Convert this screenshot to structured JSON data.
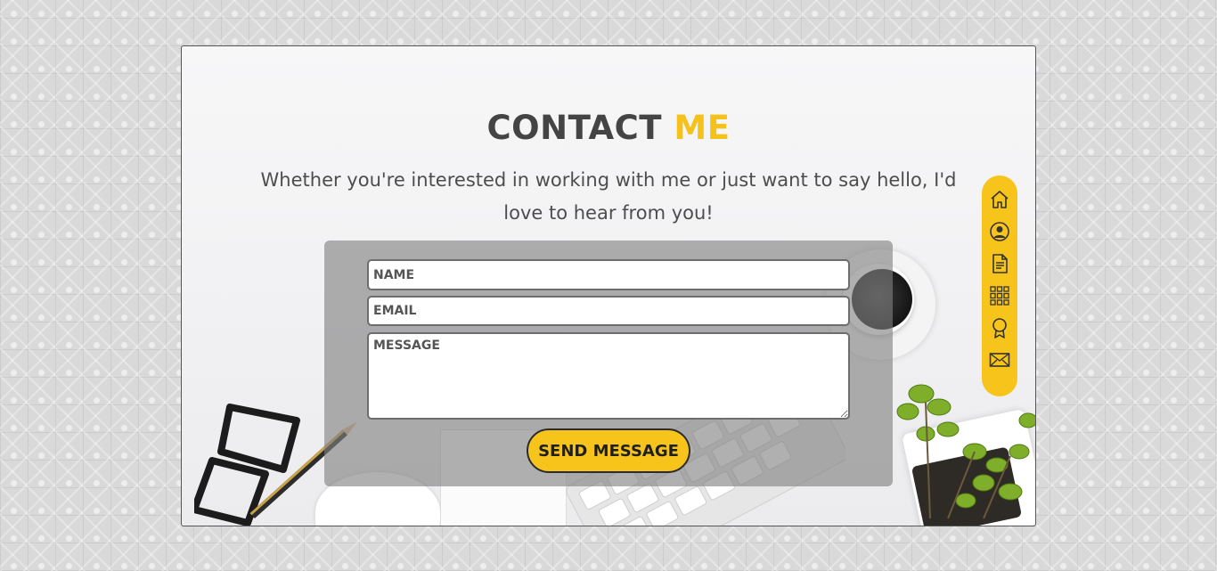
{
  "contact": {
    "title_main": "CONTACT",
    "title_accent": "ME",
    "subtitle": "Whether you're interested in working with me or just want to say hello, I'd love to hear from you!",
    "form": {
      "name_placeholder": "NAME",
      "email_placeholder": "EMAIL",
      "message_placeholder": "MESSAGE",
      "send_label": "SEND MESSAGE"
    }
  },
  "sidenav": {
    "items": [
      {
        "icon": "home-icon"
      },
      {
        "icon": "user-icon"
      },
      {
        "icon": "document-icon"
      },
      {
        "icon": "grid-icon"
      },
      {
        "icon": "award-icon"
      },
      {
        "icon": "envelope-icon"
      }
    ]
  },
  "colors": {
    "accent": "#f7c41b",
    "heading": "#444444",
    "panel": "#808080"
  }
}
